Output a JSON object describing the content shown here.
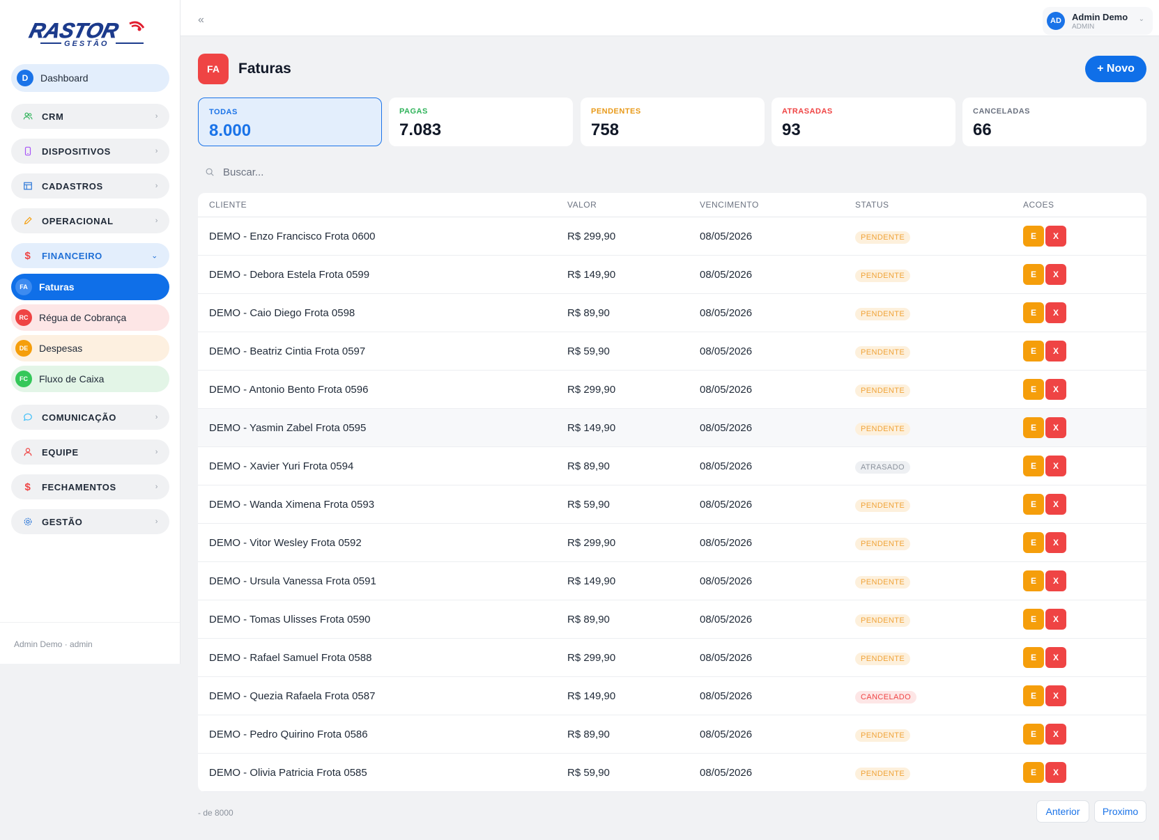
{
  "brand": {
    "logo_text": "RASTOR",
    "logo_sub": "GESTÃO"
  },
  "sidebar": {
    "dashboard": {
      "badge": "D",
      "label": "Dashboard"
    },
    "items": [
      {
        "label": "CRM",
        "icon": "users-icon"
      },
      {
        "label": "DISPOSITIVOS",
        "icon": "phone-icon"
      },
      {
        "label": "CADASTROS",
        "icon": "table-icon"
      },
      {
        "label": "OPERACIONAL",
        "icon": "pencil-icon"
      },
      {
        "label": "FINANCEIRO",
        "icon": "dollar-icon"
      },
      {
        "label": "COMUNICAÇÃO",
        "icon": "chat-icon"
      },
      {
        "label": "EQUIPE",
        "icon": "user-icon"
      },
      {
        "label": "FECHAMENTOS",
        "icon": "dollar-icon"
      },
      {
        "label": "GESTÃO",
        "icon": "gear-icon"
      }
    ],
    "sub_items": [
      {
        "badge": "FA",
        "label": "Faturas"
      },
      {
        "badge": "RC",
        "label": "Régua de Cobrança"
      },
      {
        "badge": "DE",
        "label": "Despesas"
      },
      {
        "badge": "FC",
        "label": "Fluxo de Caixa"
      }
    ],
    "footer": "Admin Demo · admin"
  },
  "topbar": {
    "collapse": "«",
    "user_initials": "AD",
    "user_name": "Admin Demo",
    "user_role": "ADMIN"
  },
  "header": {
    "badge": "FA",
    "title": "Faturas",
    "new_button": "+ Novo"
  },
  "stats": [
    {
      "label": "TODAS",
      "value": "8.000",
      "color": "#1a73e8"
    },
    {
      "label": "PAGAS",
      "value": "7.083",
      "color": "#2fb35a"
    },
    {
      "label": "PENDENTES",
      "value": "758",
      "color": "#e89a1a"
    },
    {
      "label": "ATRASADAS",
      "value": "93",
      "color": "#ef4444"
    },
    {
      "label": "CANCELADAS",
      "value": "66",
      "color": "#6b7280"
    }
  ],
  "search": {
    "placeholder": "Buscar..."
  },
  "table": {
    "columns": [
      "CLIENTE",
      "VALOR",
      "VENCIMENTO",
      "STATUS",
      "ACOES"
    ],
    "rows": [
      {
        "cliente": "DEMO - Enzo Francisco Frota 0600",
        "valor": "R$ 299,90",
        "vencimento": "08/05/2026",
        "status": "PENDENTE"
      },
      {
        "cliente": "DEMO - Debora Estela Frota 0599",
        "valor": "R$ 149,90",
        "vencimento": "08/05/2026",
        "status": "PENDENTE"
      },
      {
        "cliente": "DEMO - Caio Diego Frota 0598",
        "valor": "R$ 89,90",
        "vencimento": "08/05/2026",
        "status": "PENDENTE"
      },
      {
        "cliente": "DEMO - Beatriz Cintia Frota 0597",
        "valor": "R$ 59,90",
        "vencimento": "08/05/2026",
        "status": "PENDENTE"
      },
      {
        "cliente": "DEMO - Antonio Bento Frota 0596",
        "valor": "R$ 299,90",
        "vencimento": "08/05/2026",
        "status": "PENDENTE"
      },
      {
        "cliente": "DEMO - Yasmin Zabel Frota 0595",
        "valor": "R$ 149,90",
        "vencimento": "08/05/2026",
        "status": "PENDENTE"
      },
      {
        "cliente": "DEMO - Xavier Yuri Frota 0594",
        "valor": "R$ 89,90",
        "vencimento": "08/05/2026",
        "status": "ATRASADO"
      },
      {
        "cliente": "DEMO - Wanda Ximena Frota 0593",
        "valor": "R$ 59,90",
        "vencimento": "08/05/2026",
        "status": "PENDENTE"
      },
      {
        "cliente": "DEMO - Vitor Wesley Frota 0592",
        "valor": "R$ 299,90",
        "vencimento": "08/05/2026",
        "status": "PENDENTE"
      },
      {
        "cliente": "DEMO - Ursula Vanessa Frota 0591",
        "valor": "R$ 149,90",
        "vencimento": "08/05/2026",
        "status": "PENDENTE"
      },
      {
        "cliente": "DEMO - Tomas Ulisses Frota 0590",
        "valor": "R$ 89,90",
        "vencimento": "08/05/2026",
        "status": "PENDENTE"
      },
      {
        "cliente": "DEMO - Rafael Samuel Frota 0588",
        "valor": "R$ 299,90",
        "vencimento": "08/05/2026",
        "status": "PENDENTE"
      },
      {
        "cliente": "DEMO - Quezia Rafaela Frota 0587",
        "valor": "R$ 149,90",
        "vencimento": "08/05/2026",
        "status": "CANCELADO"
      },
      {
        "cliente": "DEMO - Pedro Quirino Frota 0586",
        "valor": "R$ 89,90",
        "vencimento": "08/05/2026",
        "status": "PENDENTE"
      },
      {
        "cliente": "DEMO - Olivia Patricia Frota 0585",
        "valor": "R$ 59,90",
        "vencimento": "08/05/2026",
        "status": "PENDENTE"
      }
    ],
    "action_edit": "E",
    "action_delete": "X"
  },
  "pagination": {
    "count": "- de 8000",
    "prev": "Anterior",
    "next": "Proximo"
  }
}
